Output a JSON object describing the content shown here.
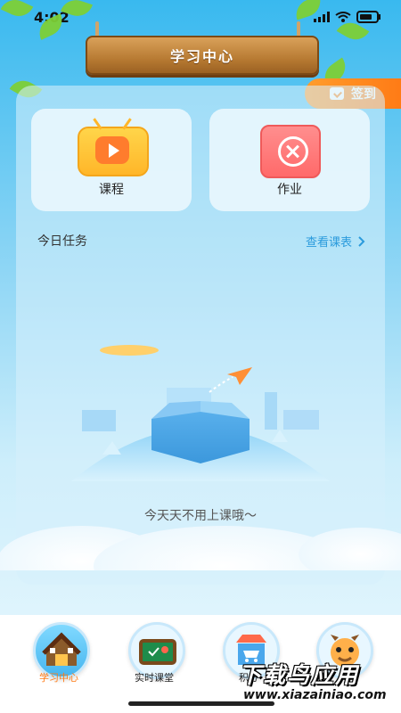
{
  "status": {
    "time": "4:02"
  },
  "header": {
    "title": "学习中心"
  },
  "signin": {
    "label": "签到"
  },
  "cards": [
    {
      "label": "课程",
      "icon": "tv-play-icon"
    },
    {
      "label": "作业",
      "icon": "homework-book-icon"
    }
  ],
  "tasks": {
    "title": "今日任务",
    "link_label": "查看课表",
    "link_icon": "chevron-right-icon",
    "empty_message": "今天天不用上课哦～"
  },
  "tabbar": {
    "items": [
      {
        "label": "学习中心",
        "active": true,
        "icon": "house-icon"
      },
      {
        "label": "实时课堂",
        "active": false,
        "icon": "classroom-board-icon"
      },
      {
        "label": "积分",
        "active": false,
        "icon": "shop-icon"
      },
      {
        "label": "",
        "active": false,
        "icon": "mascot-icon"
      }
    ]
  },
  "watermark": {
    "text": "下载鸟应用",
    "url": "www.xiazainiao.com"
  },
  "colors": {
    "accent": "#ff7b16",
    "link": "#2b9bdc",
    "sky_top": "#39b9ef"
  }
}
